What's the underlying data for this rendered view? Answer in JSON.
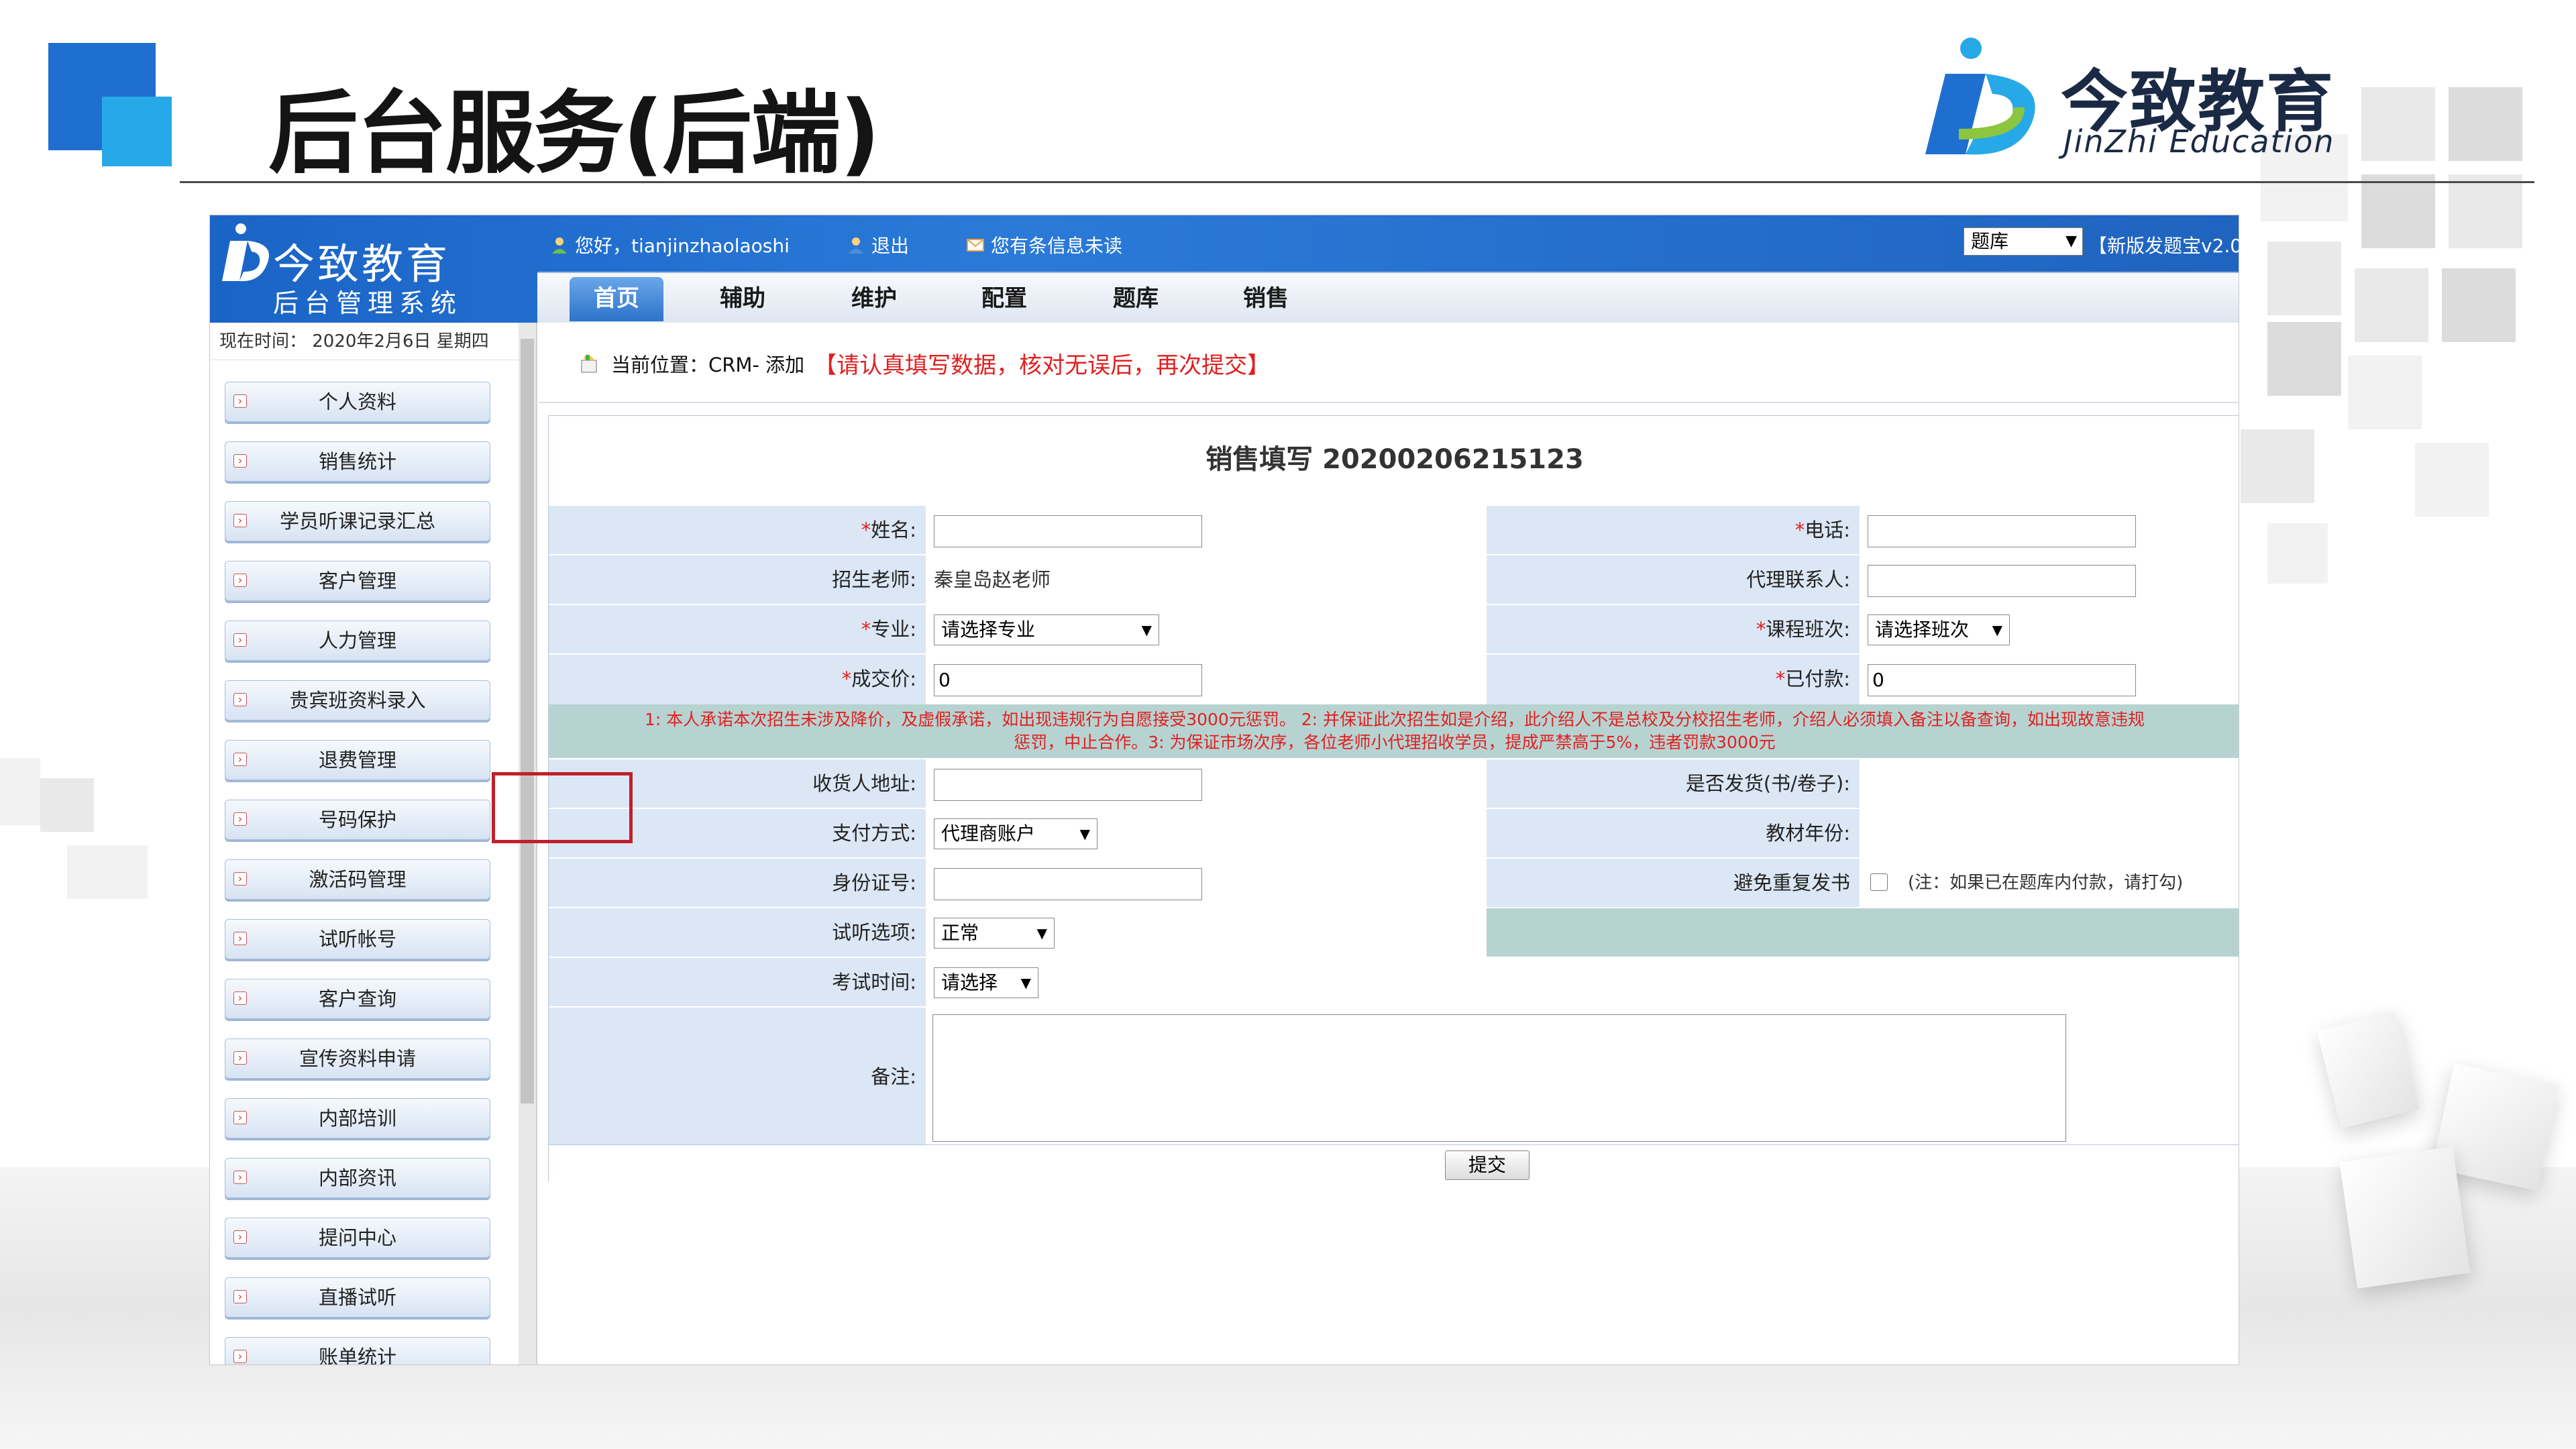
{
  "slide": {
    "title": "后台服务(后端)",
    "brand_cn": "今致教育",
    "brand_en": "JinZhi Education"
  },
  "app": {
    "logo_cn": "今致教育",
    "logo_sub": "后台管理系统",
    "greeting": "您好，tianjinzhaolaoshi",
    "logout": "退出",
    "messages": "您有条信息未读",
    "tiku_select": "题库",
    "tiku_link": "【新版发题宝v2.0",
    "tabs": [
      {
        "label": "首页",
        "active": true
      },
      {
        "label": "辅助",
        "active": false
      },
      {
        "label": "维护",
        "active": false
      },
      {
        "label": "配置",
        "active": false
      },
      {
        "label": "题库",
        "active": false
      },
      {
        "label": "销售",
        "active": false
      }
    ],
    "date_text": "现在时间： 2020年2月6日 星期四",
    "sidebar": [
      "个人资料",
      "销售统计",
      "学员听课记录汇总",
      "客户管理",
      "人力管理",
      "贵宾班资料录入",
      "退费管理",
      "号码保护",
      "激活码管理",
      "试听帐号",
      "客户查询",
      "宣传资料申请",
      "内部培训",
      "内部资讯",
      "提问中心",
      "直播试听",
      "账单统计"
    ],
    "crumb_label": "当前位置：CRM- 添加",
    "crumb_warning": "【请认真填写数据，核对无误后，再次提交】",
    "form": {
      "title": "销售填写 20200206215123",
      "name_label": "姓名:",
      "phone_label": "电话:",
      "teacher_label": "招生老师:",
      "teacher_value": "秦皇岛赵老师",
      "agent_label": "代理联系人:",
      "major_label": "专业:",
      "major_select": "请选择专业",
      "class_label": "课程班次:",
      "class_select": "请选择班次",
      "price_label": "成交价:",
      "price_value": "0",
      "paid_label": "已付款:",
      "paid_value": "0",
      "notice_line1": "1: 本人承诺本次招生未涉及降价，及虚假承诺，如出现违规行为自愿接受3000元惩罚。 2: 并保证此次招生如是介绍，此介绍人不是总校及分校招生老师，介绍人必须填入备注以备查询，如出现故意违规",
      "notice_line2": "惩罚，中止合作。3: 为保证市场次序，各位老师小代理招收学员，提成严禁高于5%，违者罚款3000元",
      "address_label": "收货人地址:",
      "ship_label": "是否发货(书/卷子):",
      "pay_label": "支付方式:",
      "pay_select": "代理商账户",
      "year_label": "教材年份:",
      "id_label": "身份证号:",
      "dup_label": "避免重复发书",
      "dup_note": "(注：如果已在题库内付款，请打勾)",
      "trial_label": "试听选项:",
      "trial_select": "正常",
      "exam_label": "考试时间:",
      "exam_select": "请选择",
      "remark_label": "备注:",
      "submit": "提交"
    }
  }
}
